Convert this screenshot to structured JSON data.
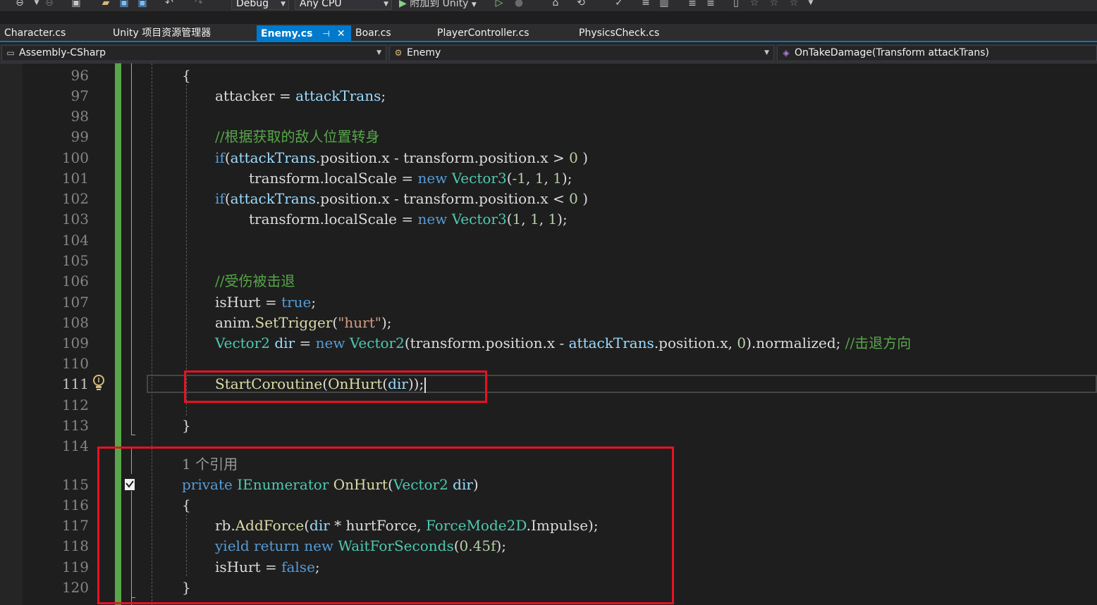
{
  "toolbar": {
    "config": "Debug",
    "platform": "Any CPU",
    "attach_label": "附加到 Unity"
  },
  "tabs": [
    {
      "label": "Character.cs"
    },
    {
      "label": "Unity 项目资源管理器"
    },
    {
      "label": "Enemy.cs",
      "active": true
    },
    {
      "label": "Boar.cs"
    },
    {
      "label": "PlayerController.cs"
    },
    {
      "label": "PhysicsCheck.cs"
    }
  ],
  "nav": {
    "project": "Assembly-CSharp",
    "class": "Enemy",
    "member": "OnTakeDamage(Transform attackTrans)"
  },
  "editor": {
    "line_numbers": [
      "96",
      "97",
      "98",
      "99",
      "100",
      "101",
      "102",
      "103",
      "104",
      "105",
      "106",
      "107",
      "108",
      "109",
      "110",
      "111",
      "112",
      "113",
      "114",
      "115",
      "116",
      "117",
      "118",
      "119",
      "120"
    ],
    "codelens": "1 个引用",
    "code": {
      "l96": "{",
      "l97": [
        "attacker",
        " = ",
        "attackTrans",
        ";"
      ],
      "l99": "//根据获取的敌人位置转身",
      "l100": [
        "if",
        "(",
        "attackTrans",
        ".position.x - transform.position.x > ",
        "0",
        " )"
      ],
      "l101": [
        "transform.localScale = ",
        "new",
        " ",
        "Vector3",
        "(",
        "-1",
        ", ",
        "1",
        ", ",
        "1",
        ");"
      ],
      "l102": [
        "if",
        "(",
        "attackTrans",
        ".position.x - transform.position.x < ",
        "0",
        " )"
      ],
      "l103": [
        "transform.localScale = ",
        "new",
        " ",
        "Vector3",
        "(",
        "1",
        ", ",
        "1",
        ", ",
        "1",
        ");"
      ],
      "l106": "//受伤被击退",
      "l107": [
        "isHurt",
        " = ",
        "true",
        ";"
      ],
      "l108": [
        "anim.",
        "SetTrigger",
        "(",
        "\"hurt\"",
        ");"
      ],
      "l109": [
        "Vector2",
        " ",
        "dir",
        " = ",
        "new",
        " ",
        "Vector2",
        "(transform.position.x - ",
        "attackTrans",
        ".position.x, ",
        "0",
        ").normalized; ",
        "//击退方向"
      ],
      "l111": [
        "StartCoroutine",
        "(",
        "OnHurt",
        "(",
        "dir",
        "));"
      ],
      "l113": "}",
      "l115": [
        "private",
        " ",
        "IEnumerator",
        " ",
        "OnHurt",
        "(",
        "Vector2",
        " ",
        "dir",
        ")"
      ],
      "l116": "{",
      "l117": [
        "rb.",
        "AddForce",
        "(",
        "dir",
        " * hurtForce, ",
        "ForceMode2D",
        ".Impulse);"
      ],
      "l118": [
        "yield",
        " ",
        "return",
        " ",
        "new",
        " ",
        "WaitForSeconds",
        "(",
        "0.45f",
        ");"
      ],
      "l119": [
        "isHurt",
        " = ",
        "false",
        ";"
      ],
      "l120": "}"
    }
  },
  "colors": {
    "keyword": "#569cd6",
    "type": "#4ec9b0",
    "method": "#dcdcaa",
    "comment": "#57a64a",
    "string": "#d69d85",
    "number": "#b5cea8",
    "highlight_box": "#e81123",
    "active_tab": "#007acc"
  }
}
